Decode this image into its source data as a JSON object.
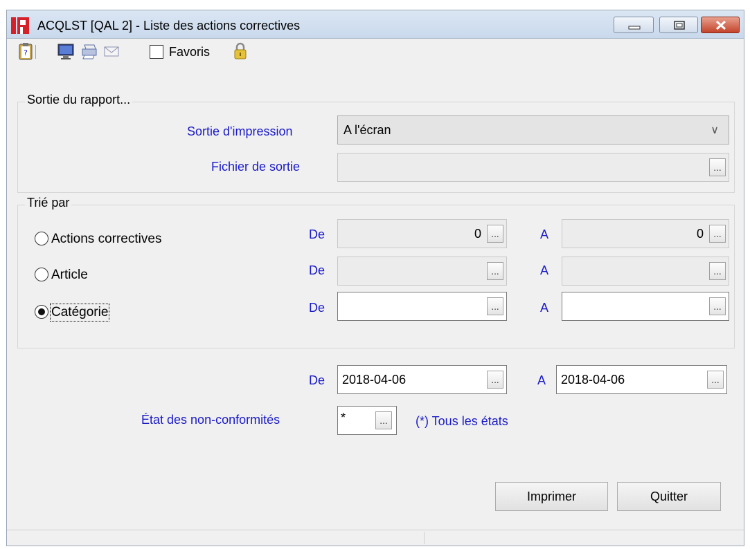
{
  "window": {
    "title": "ACQLST [QAL 2] - Liste des actions correctives"
  },
  "toolbar": {
    "favorites_label": "Favoris",
    "favorites_checked": false
  },
  "output_group": {
    "title": "Sortie du rapport...",
    "print_output_label": "Sortie d'impression",
    "print_output_value": "A l'écran",
    "output_file_label": "Fichier de sortie",
    "output_file_value": ""
  },
  "sort_group": {
    "title": "Trié par",
    "rows": [
      {
        "label": "Actions correctives",
        "selected": false,
        "from_label": "De",
        "to_label": "A",
        "from_value": "0",
        "to_value": "0"
      },
      {
        "label": "Article",
        "selected": false,
        "from_label": "De",
        "to_label": "A",
        "from_value": "",
        "to_value": ""
      },
      {
        "label": "Catégorie",
        "selected": true,
        "from_label": "De",
        "to_label": "A",
        "from_value": "",
        "to_value": ""
      }
    ]
  },
  "date_range": {
    "from_label": "De",
    "to_label": "A",
    "from_value": "2018-04-06",
    "to_value": "2018-04-06"
  },
  "nc_state": {
    "label": "État des non-conformités",
    "value": "*",
    "hint": "(*) Tous les états"
  },
  "buttons": {
    "ellipsis": "...",
    "print": "Imprimer",
    "quit": "Quitter"
  },
  "colors": {
    "label_blue": "#1a1ac8",
    "close_red": "#c4442b",
    "app_icon_red": "#d4212a"
  }
}
